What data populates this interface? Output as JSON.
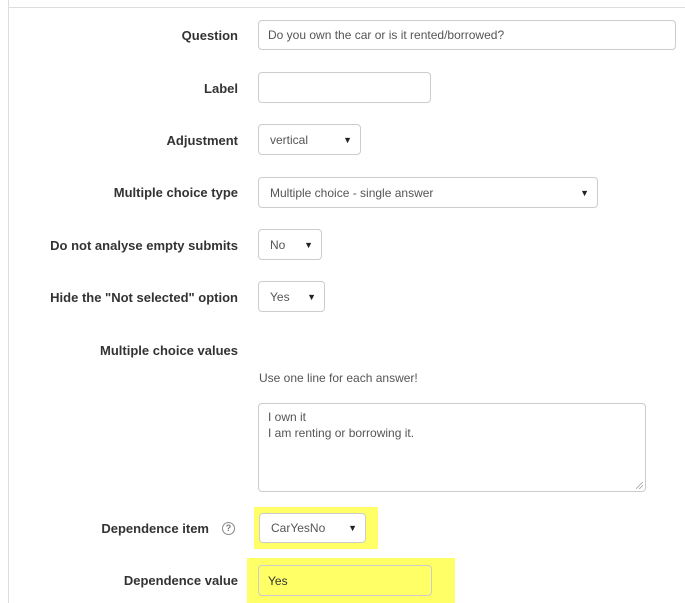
{
  "form": {
    "question": {
      "label": "Question",
      "value": "Do you own the car or is it rented/borrowed?"
    },
    "label_field": {
      "label": "Label",
      "value": ""
    },
    "adjustment": {
      "label": "Adjustment",
      "selected": "vertical"
    },
    "multiple_choice_type": {
      "label": "Multiple choice type",
      "selected": "Multiple choice - single answer"
    },
    "do_not_analyse": {
      "label": "Do not analyse empty submits",
      "selected": "No"
    },
    "hide_not_selected": {
      "label": "Hide the \"Not selected\" option",
      "selected": "Yes"
    },
    "multiple_choice_values": {
      "label": "Multiple choice values",
      "help": "Use one line for each answer!",
      "value": "I own it\nI am renting or borrowing it."
    },
    "dependence_item": {
      "label": "Dependence item",
      "selected": "CarYesNo"
    },
    "dependence_value": {
      "label": "Dependence value",
      "value": "Yes"
    }
  },
  "icons": {
    "dropdown": "caret-down-icon",
    "help": "help-circle-icon",
    "resize": "resize-grip-icon"
  },
  "colors": {
    "highlight": "#ffff66",
    "border": "#cccccc"
  }
}
